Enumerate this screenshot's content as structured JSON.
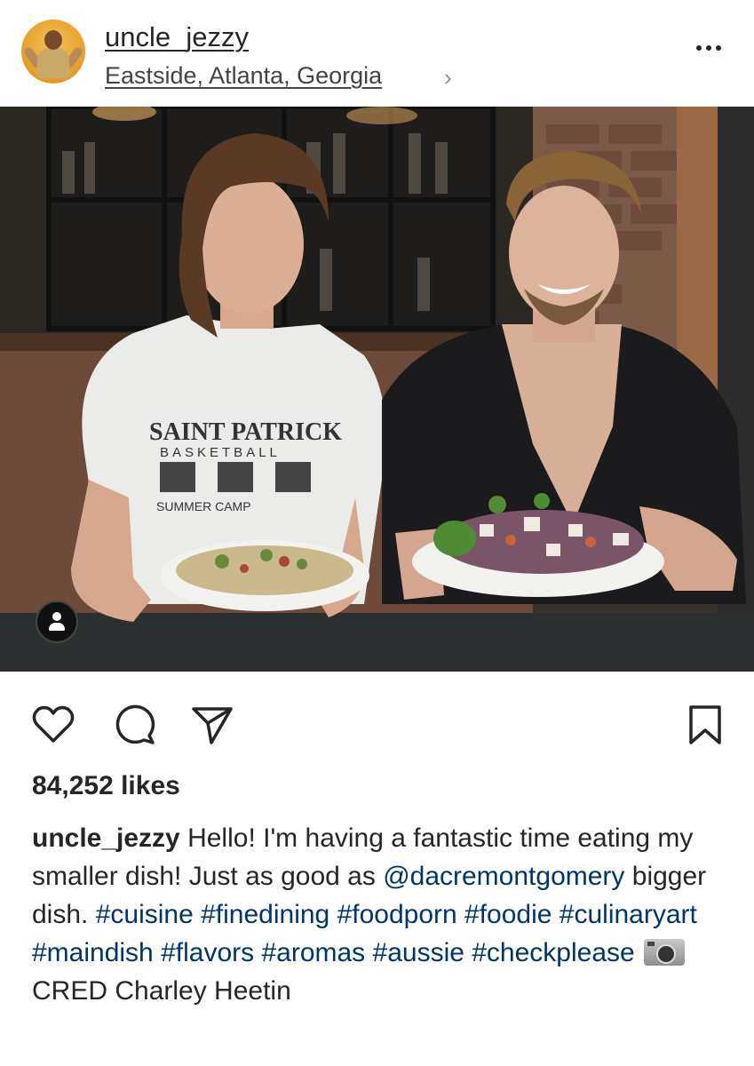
{
  "post": {
    "username": "uncle_jezzy",
    "location": "Eastside, Atlanta, Georgia",
    "location_chevron": "›",
    "more_icon": "more-dots-icon",
    "likes": "84,252 likes",
    "caption": {
      "user": "uncle_jezzy",
      "text_1": " Hello! I'm having a fantastic time eating my smaller dish! Just as good as ",
      "mention": "@dacremontgomery",
      "text_2": " bigger dish. ",
      "hashtags_1": "#cuisine #finedining #foodporn #foodie #culinaryart #maindish #flavors #aromas #aussie #checkplease",
      "credit": "CRED Charley Heetin"
    },
    "shirt_text": {
      "line1": "SAINT PATRICK",
      "line2": "BASKETBALL",
      "line3": "SUMMER CAMP"
    }
  },
  "actions": {
    "like_icon": "heart-icon",
    "comment_icon": "comment-icon",
    "share_icon": "share-icon",
    "save_icon": "bookmark-icon"
  },
  "colors": {
    "text": "#262626",
    "link": "#003569",
    "secondary": "#8e8e8e"
  }
}
